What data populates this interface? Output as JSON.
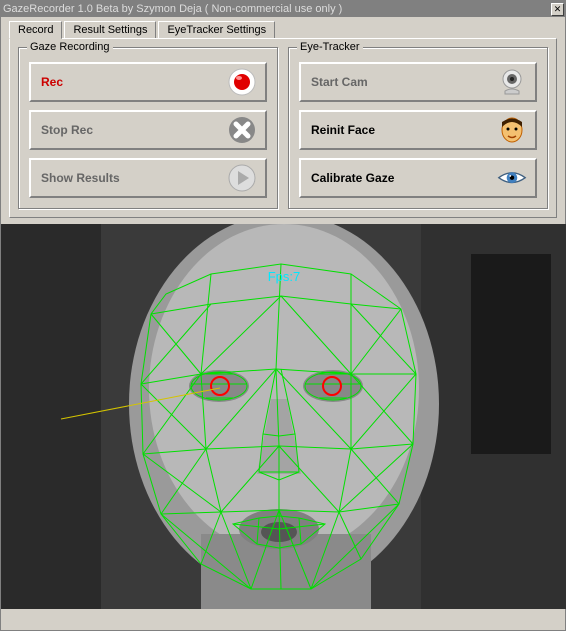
{
  "titlebar": "GazeRecorder 1.0 Beta  by Szymon Deja  ( Non-commercial use only )",
  "tabs": {
    "record": "Record",
    "result_settings": "Result Settings",
    "eyetracker_settings": "EyeTracker Settings"
  },
  "groups": {
    "gaze_recording": "Gaze Recording",
    "eye_tracker": "Eye-Tracker"
  },
  "buttons": {
    "rec": "Rec ",
    "stop_rec": "Stop Rec",
    "show_results": "Show Results",
    "start_cam": "Start Cam",
    "reinit_face": "Reinit Face",
    "calibrate_gaze": "Calibrate Gaze"
  },
  "preview": {
    "fps_label": "Fps:7",
    "mesh_color": "#00e000",
    "pupil_color": "#ff0000",
    "gaze_line_color": "#d4c400"
  }
}
